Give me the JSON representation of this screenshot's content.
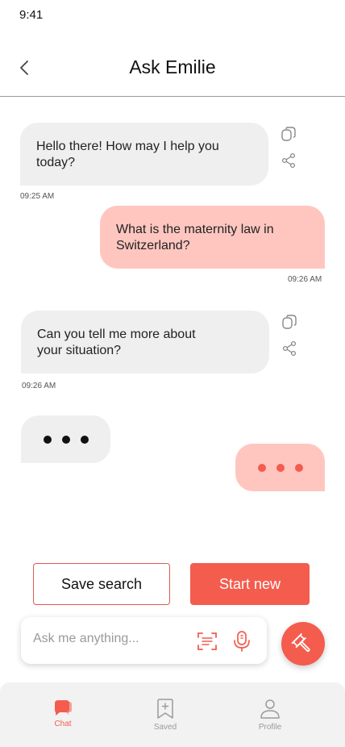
{
  "status": {
    "time": "9:41"
  },
  "header": {
    "title": "Ask Emilie"
  },
  "messages": [
    {
      "role": "assistant",
      "text": "Hello there! How may I help you today?",
      "time": "09:25 AM"
    },
    {
      "role": "user",
      "text": "What is the maternity law in Switzerland?",
      "time": "09:26 AM"
    },
    {
      "role": "assistant",
      "text": "Can you tell me more about your situation?",
      "time": "09:26 AM"
    }
  ],
  "actions": {
    "save_label": "Save search",
    "start_label": "Start new"
  },
  "search": {
    "placeholder": "Ask me anything..."
  },
  "nav": {
    "items": [
      {
        "label": "Chat",
        "icon": "chat-icon",
        "active": true
      },
      {
        "label": "Saved",
        "icon": "bookmark-icon",
        "active": false
      },
      {
        "label": "Profile",
        "icon": "profile-icon",
        "active": false
      }
    ]
  },
  "colors": {
    "accent": "#f45c4e",
    "user_bubble": "#ffc6c0",
    "assistant_bubble": "#efefef",
    "inactive": "#9a9a9a"
  }
}
